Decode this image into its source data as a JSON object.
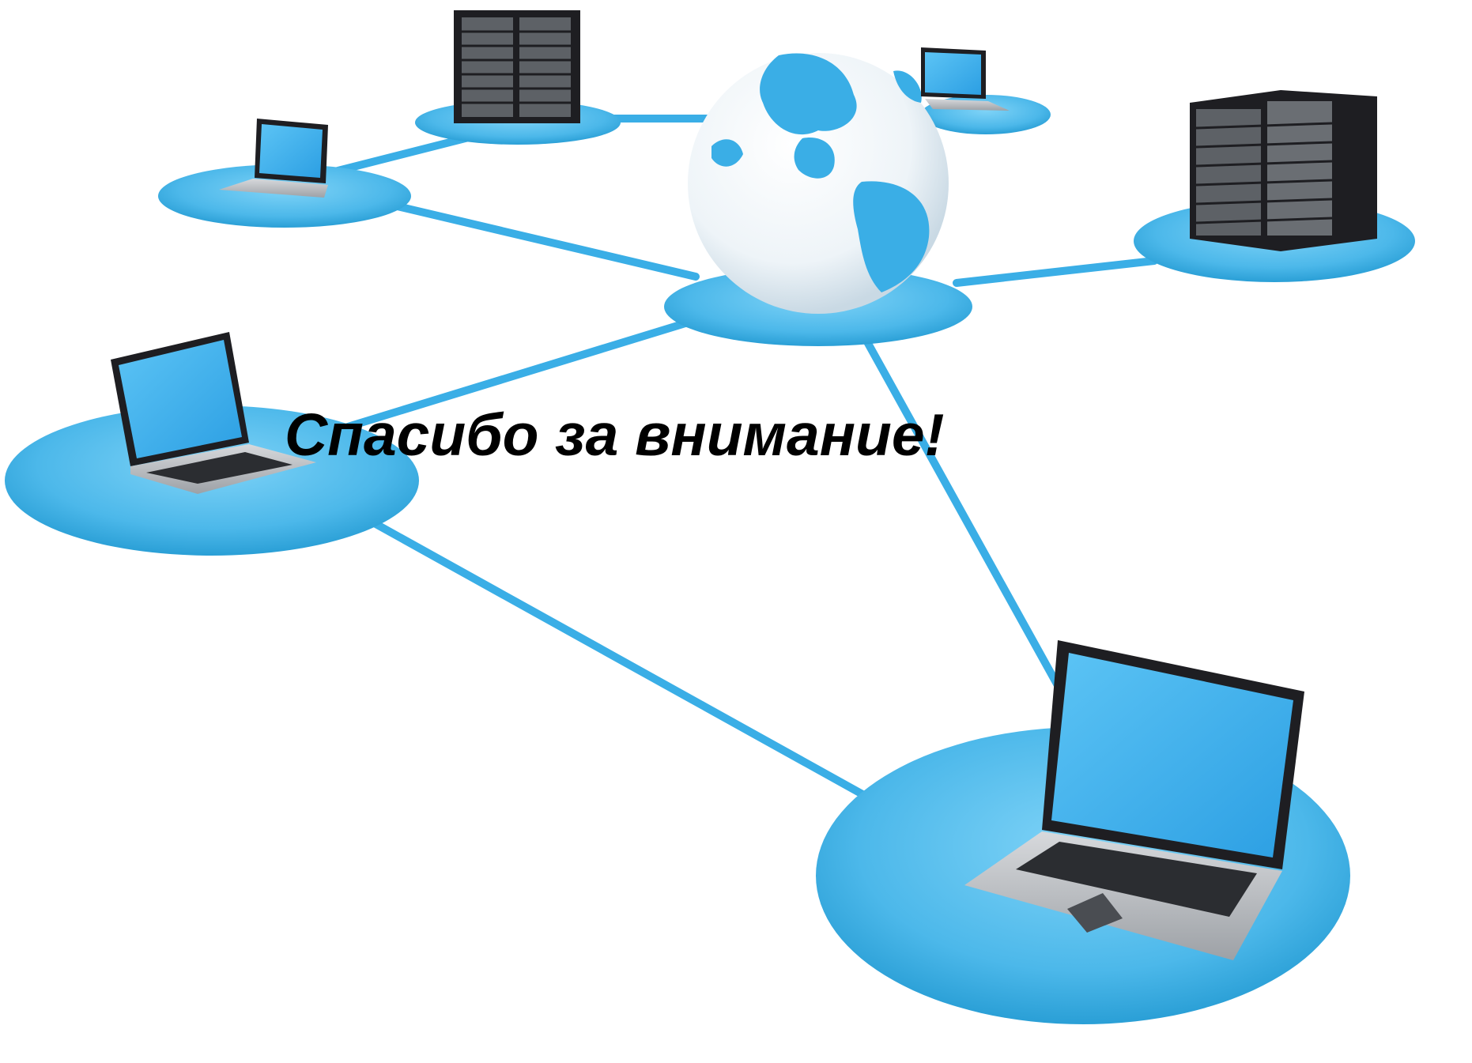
{
  "slide": {
    "title": "Спасибо за внимание!"
  },
  "illustration": {
    "subject": "computer-network",
    "icons": [
      "globe-icon",
      "server-rack-icon",
      "laptop-icon"
    ],
    "colors": {
      "background": "#ffffff",
      "platform": "#4cb8ea",
      "platform_dark": "#2a9fd6",
      "cable": "#3aaee6",
      "screen": "#38aef0",
      "server_body": "#1e1e22",
      "laptop_body": "#b9bcc1"
    }
  }
}
